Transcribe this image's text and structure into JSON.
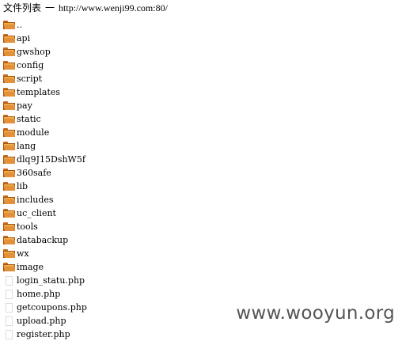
{
  "header": {
    "title": "文件列表",
    "dash": "一",
    "url": "http://www.wenji99.com:80/"
  },
  "entries": [
    {
      "name": "..",
      "type": "folder",
      "icon": "folder-icon"
    },
    {
      "name": "api",
      "type": "folder",
      "icon": "folder-icon"
    },
    {
      "name": "gwshop",
      "type": "folder",
      "icon": "folder-icon"
    },
    {
      "name": "config",
      "type": "folder",
      "icon": "folder-icon"
    },
    {
      "name": "script",
      "type": "folder",
      "icon": "folder-icon"
    },
    {
      "name": "templates",
      "type": "folder",
      "icon": "folder-icon"
    },
    {
      "name": "pay",
      "type": "folder",
      "icon": "folder-icon"
    },
    {
      "name": "static",
      "type": "folder",
      "icon": "folder-icon"
    },
    {
      "name": "module",
      "type": "folder",
      "icon": "folder-icon"
    },
    {
      "name": "lang",
      "type": "folder",
      "icon": "folder-icon"
    },
    {
      "name": "dlq9J15DshW5f",
      "type": "folder",
      "icon": "folder-icon"
    },
    {
      "name": "360safe",
      "type": "folder",
      "icon": "folder-icon"
    },
    {
      "name": "lib",
      "type": "folder",
      "icon": "folder-icon"
    },
    {
      "name": "includes",
      "type": "folder",
      "icon": "folder-icon"
    },
    {
      "name": "uc_client",
      "type": "folder",
      "icon": "folder-icon"
    },
    {
      "name": "tools",
      "type": "folder",
      "icon": "folder-icon"
    },
    {
      "name": "databackup",
      "type": "folder",
      "icon": "folder-icon"
    },
    {
      "name": "wx",
      "type": "folder",
      "icon": "folder-icon"
    },
    {
      "name": "image",
      "type": "folder",
      "icon": "folder-icon"
    },
    {
      "name": "login_statu.php",
      "type": "file",
      "icon": "file-icon"
    },
    {
      "name": "home.php",
      "type": "file",
      "icon": "file-icon"
    },
    {
      "name": "getcoupons.php",
      "type": "file",
      "icon": "file-icon"
    },
    {
      "name": "upload.php",
      "type": "file",
      "icon": "file-icon"
    },
    {
      "name": "register.php",
      "type": "file",
      "icon": "file-icon"
    }
  ],
  "watermark": "www.wooyun.org",
  "colors": {
    "folder_light": "#f2b54e",
    "folder_dark": "#d8741c",
    "watermark": "#555555"
  }
}
